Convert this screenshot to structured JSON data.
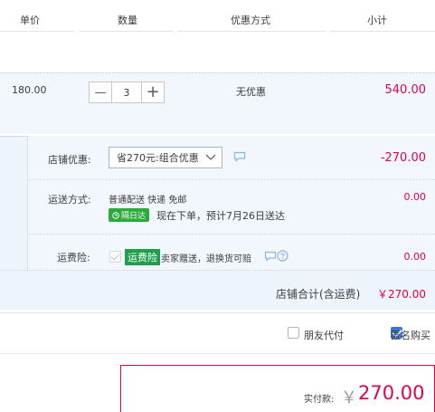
{
  "header": {
    "col_price": "单价",
    "col_qty": "数量",
    "col_promo": "优惠方式",
    "col_subtotal": "小计"
  },
  "item": {
    "price": "180.00",
    "quantity": "3",
    "minus": "—",
    "plus": "+",
    "promo": "无优惠",
    "subtotal": "540.00"
  },
  "shop": {
    "discount_label": "店铺优惠:",
    "discount_select": "省270元:组合优惠",
    "discount_amount": "-270.00",
    "shipping_label": "运送方式:",
    "shipping_method": "普通配送 快递 免邮",
    "shipping_tag": "隔日达",
    "shipping_eta": "现在下单，预计7月26日送达",
    "shipping_amount": "0.00",
    "insurance_label": "运费险:",
    "insurance_tag": "运费险",
    "insurance_text": "卖家赠送，退换货可赔",
    "insurance_amount": "0.00",
    "total_label": "店铺合计(含运费)",
    "total_amount": "￥270.00"
  },
  "options": {
    "friend_pay": "朋友代付",
    "anonymous": "匿名购买",
    "friend_pay_checked": false,
    "anonymous_checked": true
  },
  "payment": {
    "label": "实付款:",
    "currency": "￥",
    "amount": "270.00"
  },
  "colors": {
    "accent_red": "#e4004f",
    "tag_green": "#2aab3c",
    "check_blue": "#3b76e0"
  }
}
